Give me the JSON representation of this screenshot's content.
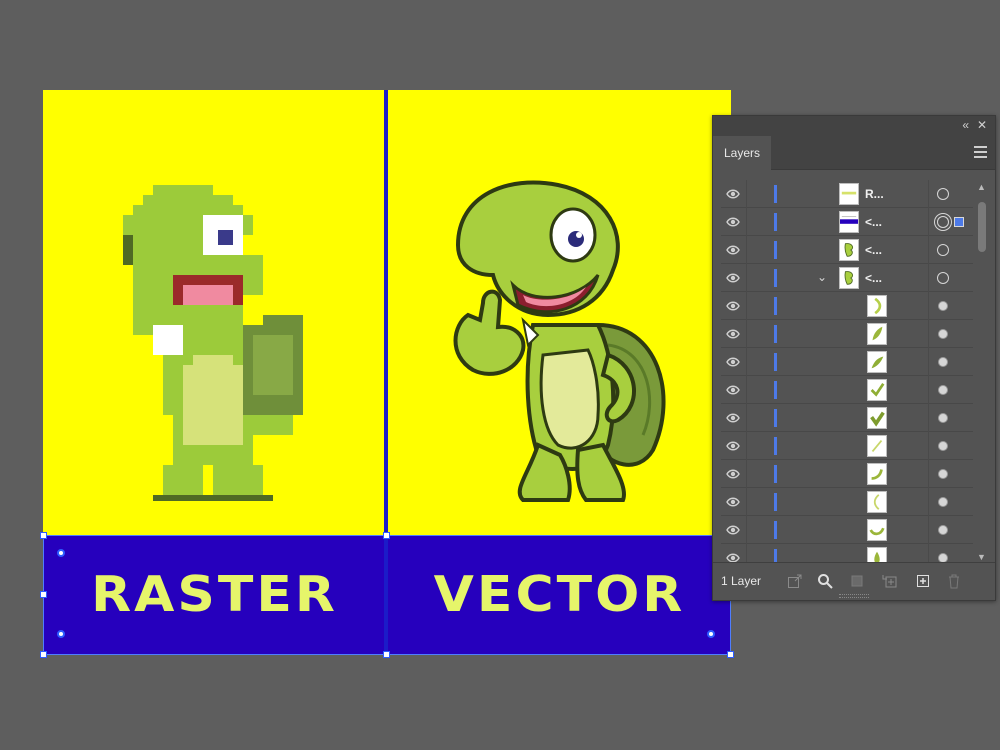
{
  "artboard": {
    "left_label": "RASTER",
    "right_label": "VECTOR",
    "bg_color": "#ffff00",
    "banner_color": "#2600bd",
    "text_color": "#e6f56a"
  },
  "layers_panel": {
    "tab_label": "Layers",
    "collapse_icon": "double-chevron-left-icon",
    "close_icon": "close-icon",
    "menu_icon": "hamburger-menu-icon",
    "layer_count": "1 Layer",
    "rows": [
      {
        "name": "R...",
        "thumb": "line",
        "target": "hollow"
      },
      {
        "name": "<...",
        "thumb": "blue-bar",
        "target": "double",
        "selected": true
      },
      {
        "name": "<...",
        "thumb": "turtle-small",
        "target": "hollow"
      },
      {
        "name": "<...",
        "thumb": "turtle-small",
        "target": "hollow",
        "expanded": true
      },
      {
        "name": "",
        "thumb": "curve-1",
        "target": "filled"
      },
      {
        "name": "",
        "thumb": "leaf-1",
        "target": "filled"
      },
      {
        "name": "",
        "thumb": "leaf-2",
        "target": "filled"
      },
      {
        "name": "",
        "thumb": "check-1",
        "target": "filled"
      },
      {
        "name": "",
        "thumb": "check-2",
        "target": "filled"
      },
      {
        "name": "",
        "thumb": "slash",
        "target": "filled"
      },
      {
        "name": "",
        "thumb": "hook",
        "target": "filled"
      },
      {
        "name": "",
        "thumb": "paren",
        "target": "filled"
      },
      {
        "name": "",
        "thumb": "smile",
        "target": "filled"
      },
      {
        "name": "",
        "thumb": "drop",
        "target": "filled"
      }
    ],
    "accent_color": "#4d7ae8"
  }
}
